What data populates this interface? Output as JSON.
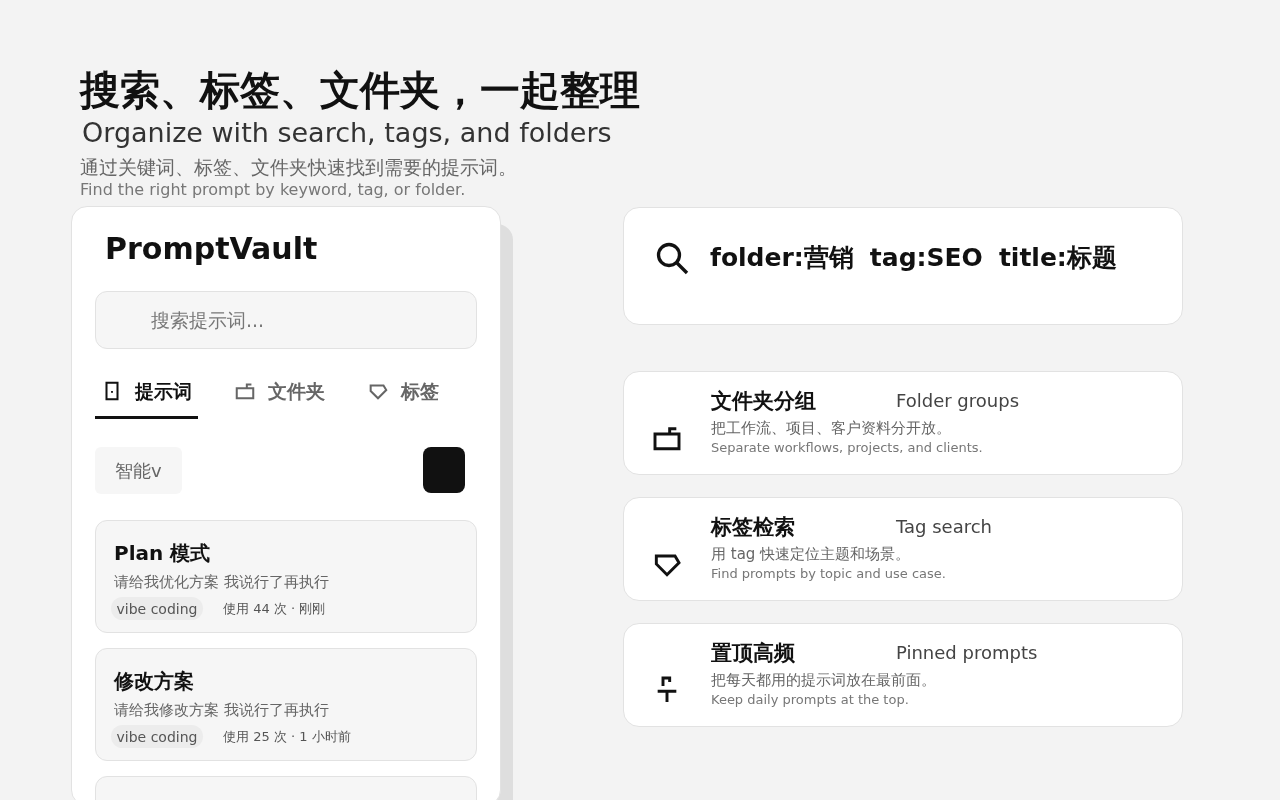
{
  "header": {
    "title_zh": "搜索、标签、文件夹，一起整理",
    "title_en": "Organize with search, tags, and folders",
    "subtitle_zh": "通过关键词、标签、文件夹快速找到需要的提示词。",
    "subtitle_en": "Find the right prompt by keyword, tag, or folder."
  },
  "app": {
    "name": "PromptVault",
    "search": {
      "placeholder": "搜索提示词..."
    },
    "tabs": [
      {
        "label": "提示词",
        "kind": "prompt",
        "selected": true
      },
      {
        "label": "文件夹",
        "kind": "folder",
        "selected": false
      },
      {
        "label": "标签",
        "kind": "tag",
        "selected": false
      }
    ],
    "sort_button": "智能v",
    "prompts": [
      {
        "title": "Plan 模式",
        "body": "请给我优化方案 我说行了再执行",
        "tag": "vibe coding",
        "meta": "使用 44 次 · 刚刚"
      },
      {
        "title": "修改方案",
        "body": "请给我修改方案 我说行了再执行",
        "tag": "vibe coding",
        "meta": "使用 25 次 · 1 小时前"
      }
    ]
  },
  "query": [
    "folder:营销",
    "tag:SEO",
    "title:标题"
  ],
  "features": [
    {
      "kind": "folder",
      "title": "文件夹分组",
      "title_en": "Folder groups",
      "desc_zh": "把工作流、项目、客户资料分开放。",
      "desc_en": "Separate workflows, projects, and clients."
    },
    {
      "kind": "tag",
      "title": "标签检索",
      "title_en": "Tag search",
      "desc_zh": "用 tag 快速定位主题和场景。",
      "desc_en": "Find prompts by topic and use case."
    },
    {
      "kind": "pin",
      "title": "置顶高频",
      "title_en": "Pinned prompts",
      "desc_zh": "把每天都用的提示词放在最前面。",
      "desc_en": "Keep daily prompts at the top."
    }
  ]
}
